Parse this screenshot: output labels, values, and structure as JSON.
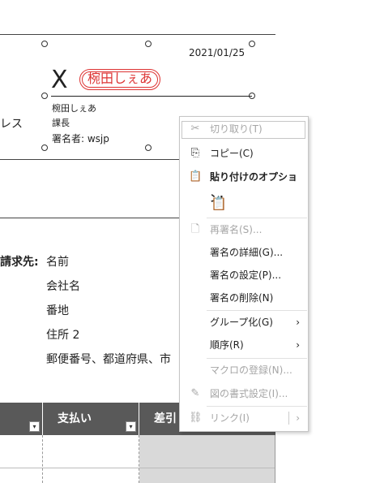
{
  "document": {
    "date": "2021/01/25",
    "signature_x": "X",
    "stamp_text": "椀田しぇあ",
    "signer_name": "椀田しぇあ",
    "signer_title": "課長",
    "signer_by": "署名者: wsjp",
    "left_fragment": "レス",
    "bill_to_label": "請求先:",
    "address_lines": [
      "名前",
      "会社名",
      "番地",
      "住所 2",
      "郵便番号、都道府県、市"
    ],
    "table_headers": {
      "payment": "支払い",
      "balance": "差引"
    }
  },
  "context_menu": {
    "cut": "切り取り(T)",
    "copy": "コピー(C)",
    "paste_options": "貼り付けのオプション:",
    "re_sign": "再署名(S)...",
    "signature_details": "署名の詳細(G)...",
    "signature_setup": "署名の設定(P)...",
    "remove_signature": "署名の削除(N)",
    "group": "グループ化(G)",
    "order": "順序(R)",
    "assign_macro": "マクロの登録(N)...",
    "format_picture": "図の書式設定(I)...",
    "link": "リンク(I)"
  },
  "colors": {
    "stamp_red": "#dd3333",
    "table_header": "#595959",
    "disabled_text": "#a6a6a6"
  }
}
